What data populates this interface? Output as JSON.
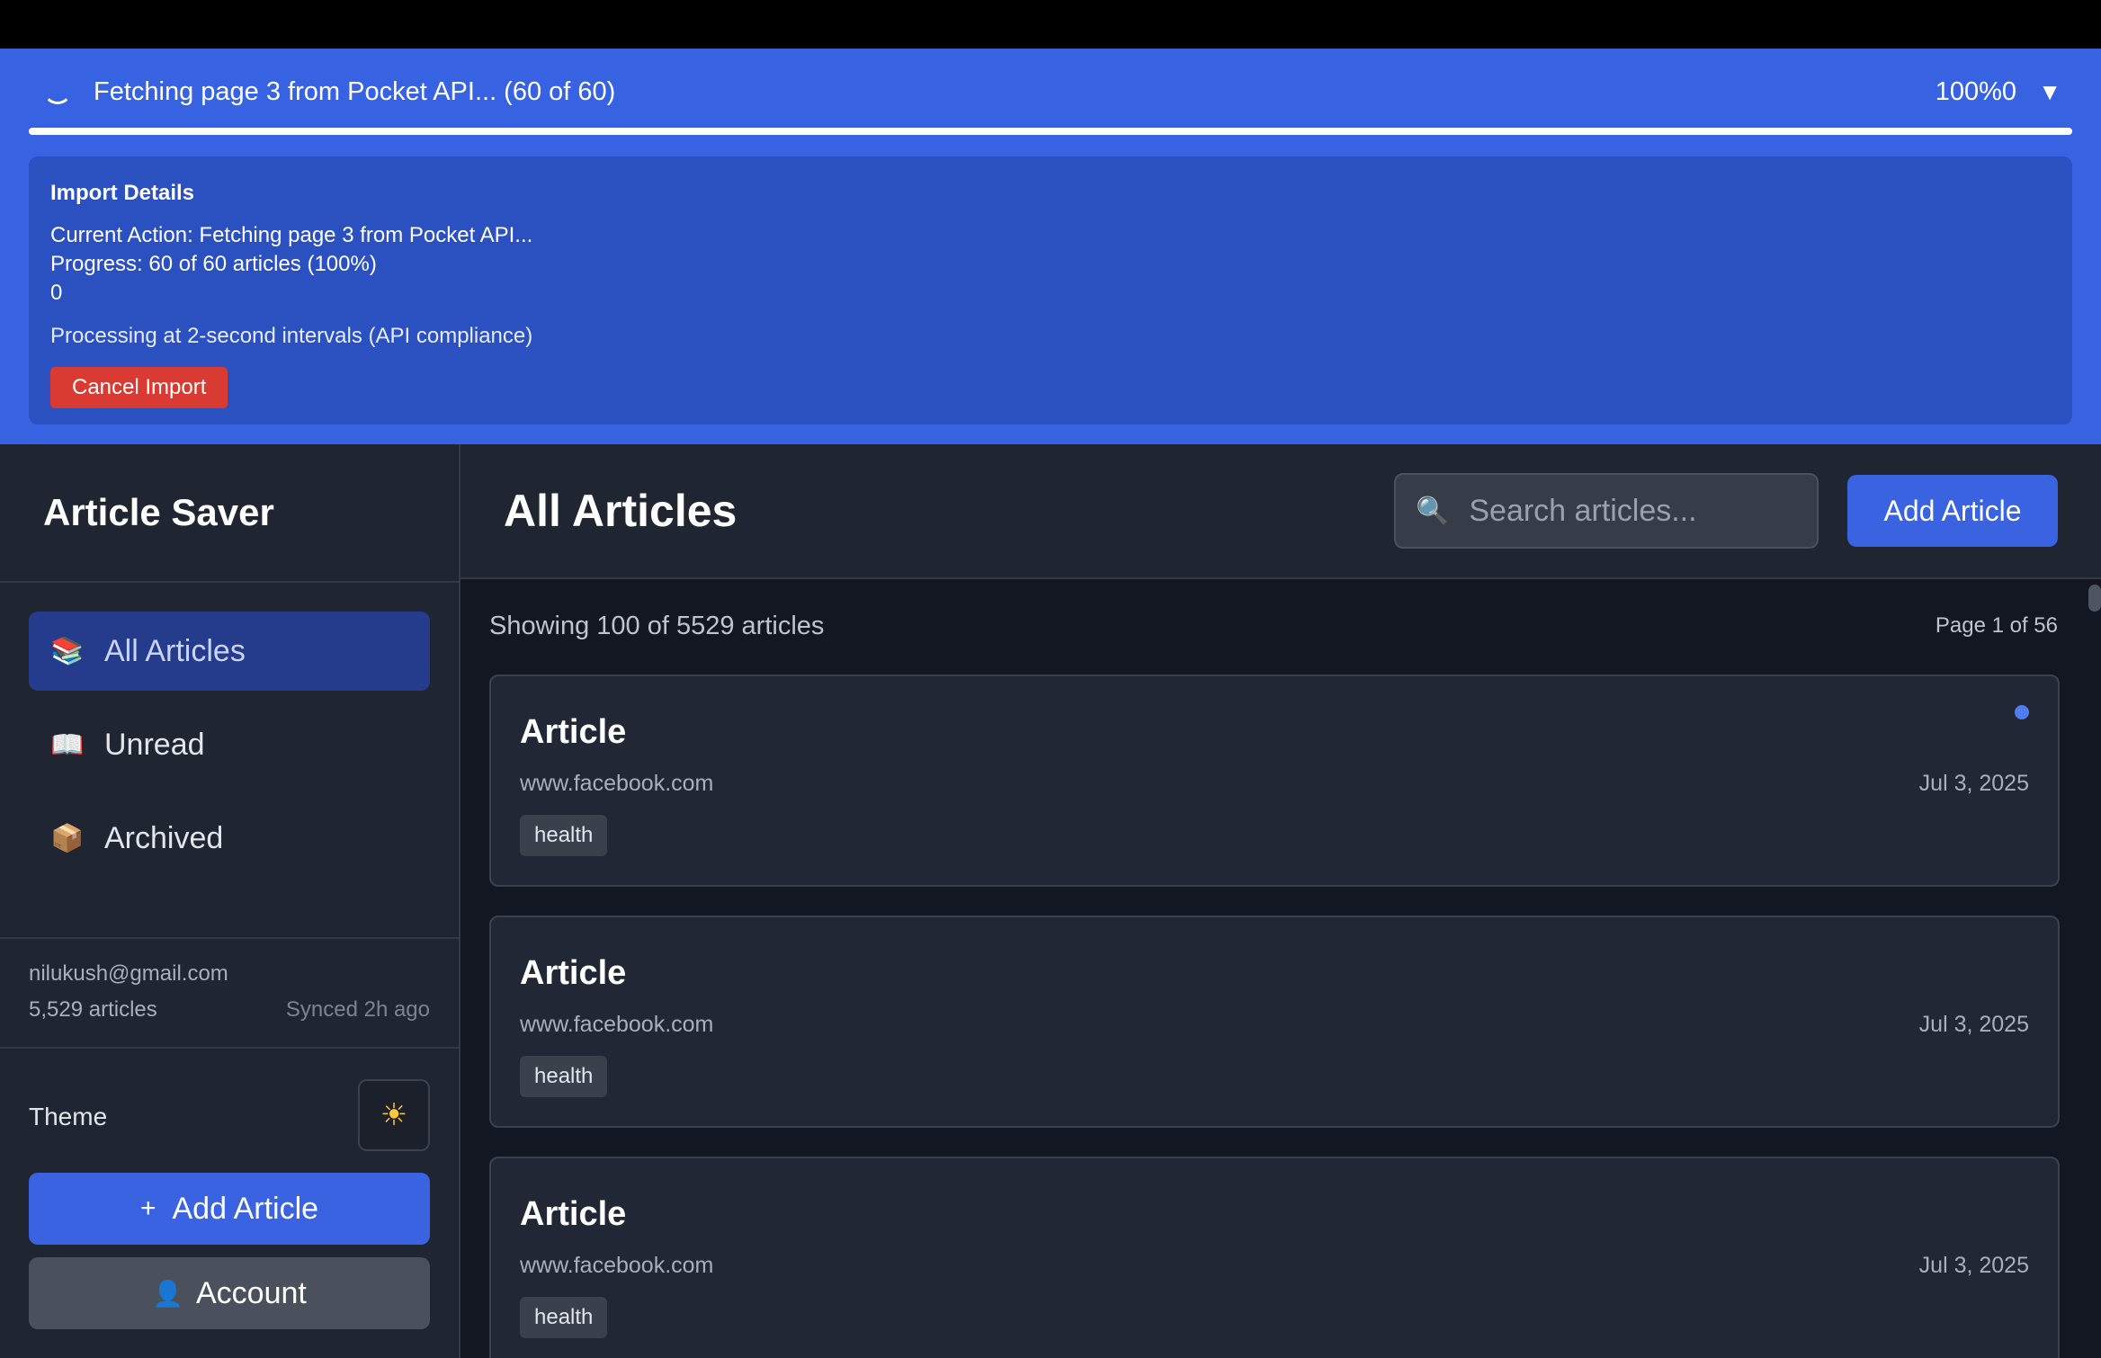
{
  "import_banner": {
    "status": "Fetching page 3 from Pocket API... (60 of 60)",
    "percent_text": "100%0",
    "toggle_icon": "▼",
    "progress_fraction": 1.0,
    "details": {
      "title": "Import Details",
      "current_action": "Current Action: Fetching page 3 from Pocket API...",
      "progress": "Progress: 60 of 60 articles (100%)",
      "extra": "0",
      "note": "Processing at 2-second intervals (API compliance)",
      "cancel_label": "Cancel Import"
    },
    "colors": {
      "banner": "#3763e2",
      "details": "#2b50bf",
      "cancel": "#d93a32"
    }
  },
  "sidebar": {
    "brand": "Article Saver",
    "items": [
      {
        "label": "All Articles",
        "icon": "📚",
        "icon_name": "books-icon",
        "active": true
      },
      {
        "label": "Unread",
        "icon": "📖",
        "icon_name": "open-book-icon",
        "active": false
      },
      {
        "label": "Archived",
        "icon": "📦",
        "icon_name": "package-icon",
        "active": false
      }
    ],
    "account": {
      "email": "nilukush@gmail.com",
      "article_count": "5,529 articles",
      "sync_status": "Synced 2h ago"
    },
    "theme": {
      "label": "Theme",
      "icon": "☀",
      "icon_name": "sun-icon"
    },
    "add_article": {
      "label": "Add Article",
      "icon": "+"
    },
    "account_button": {
      "label": "Account",
      "icon": "👤",
      "icon_name": "user-icon"
    }
  },
  "main": {
    "title": "All Articles",
    "search": {
      "placeholder": "Search articles...",
      "value": "",
      "icon": "🔍",
      "icon_name": "search-icon"
    },
    "add_button": "Add Article",
    "showing": "Showing 100 of 5529 articles",
    "page": "Page 1 of 56",
    "articles": [
      {
        "title": "Article",
        "domain": "www.facebook.com",
        "date": "Jul 3, 2025",
        "tag": "health",
        "unread": true
      },
      {
        "title": "Article",
        "domain": "www.facebook.com",
        "date": "Jul 3, 2025",
        "tag": "health",
        "unread": false
      },
      {
        "title": "Article",
        "domain": "www.facebook.com",
        "date": "Jul 3, 2025",
        "tag": "health",
        "unread": false
      }
    ]
  },
  "colors": {
    "accent": "#3a63e2",
    "sidebar_bg": "#1f2531",
    "main_bg": "#121722",
    "card_bg": "#212734",
    "unread_dot": "#4f7cf0"
  }
}
